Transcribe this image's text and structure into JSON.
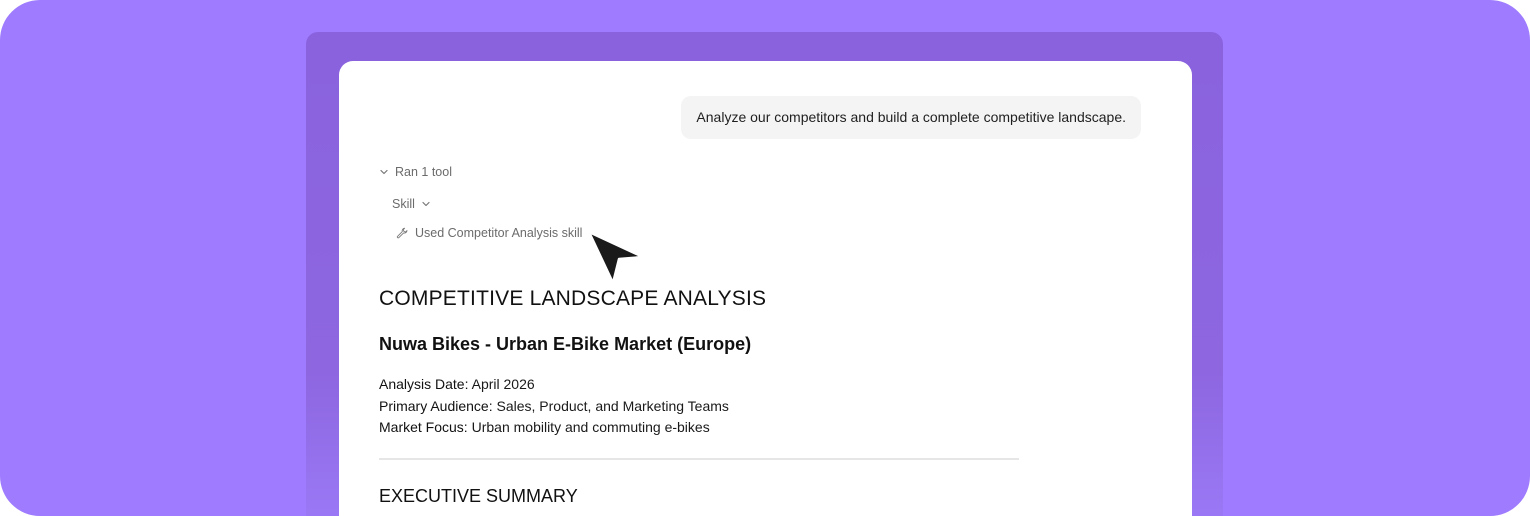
{
  "chat": {
    "user_message": "Analyze our competitors and build a complete competitive landscape.",
    "tool_summary": "Ran 1 tool",
    "skill_label": "Skill",
    "skill_used": "Used Competitor Analysis skill"
  },
  "document": {
    "title": "COMPETITIVE LANDSCAPE ANALYSIS",
    "subtitle": "Nuwa Bikes - Urban E-Bike Market (Europe)",
    "meta": [
      {
        "key": "Analysis Date:",
        "value": "April 2026"
      },
      {
        "key": "Primary Audience:",
        "value": "Sales, Product, and Marketing Teams"
      },
      {
        "key": "Market Focus:",
        "value": "Urban mobility and commuting e-bikes"
      }
    ],
    "section_heading": "EXECUTIVE SUMMARY"
  },
  "icons": {
    "tool_toggle": "chevron-down-icon",
    "skill_toggle": "chevron-down-icon",
    "skill_icon": "wrench-icon",
    "pointer": "cursor-arrow-icon"
  },
  "colors": {
    "background": "#9e7bff",
    "frame": "#8a62de",
    "card": "#ffffff",
    "bubble": "#f4f4f4"
  }
}
